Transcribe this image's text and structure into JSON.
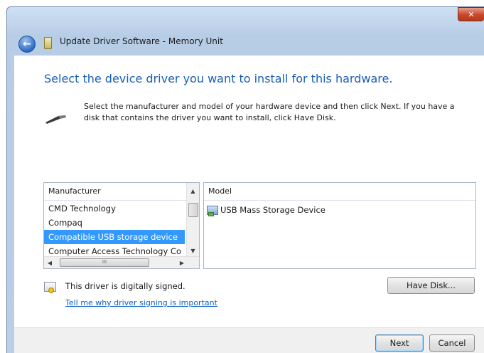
{
  "window": {
    "title": "Update Driver Software - Memory Unit",
    "close_glyph": "✕",
    "back_glyph": "←"
  },
  "main": {
    "heading": "Select the device driver you want to install for this hardware.",
    "instructions": "Select the manufacturer and model of your hardware device and then click Next. If you have a disk that contains the driver you want to install, click Have Disk."
  },
  "manufacturer_list": {
    "header": "Manufacturer",
    "items": [
      "CMD Technology",
      "Compaq",
      "Compatible USB storage device",
      "Computer Access Technology Co"
    ],
    "selected_index": 2
  },
  "model_list": {
    "header": "Model",
    "items": [
      "USB Mass Storage Device"
    ]
  },
  "signature": {
    "text": "This driver is digitally signed.",
    "link": "Tell me why driver signing is important"
  },
  "buttons": {
    "have_disk": "Have Disk...",
    "next": "Next",
    "cancel": "Cancel"
  },
  "scroll_glyphs": {
    "up": "▲",
    "down": "▼",
    "left": "◀",
    "right": "▶",
    "grip": "III"
  },
  "colors": {
    "accent": "#1a5fb4",
    "selection": "#3399ff",
    "link": "#0b62c4"
  },
  "icons": [
    "back-arrow-icon",
    "window-icon",
    "wand-icon",
    "model-device-icon",
    "certificate-icon"
  ]
}
